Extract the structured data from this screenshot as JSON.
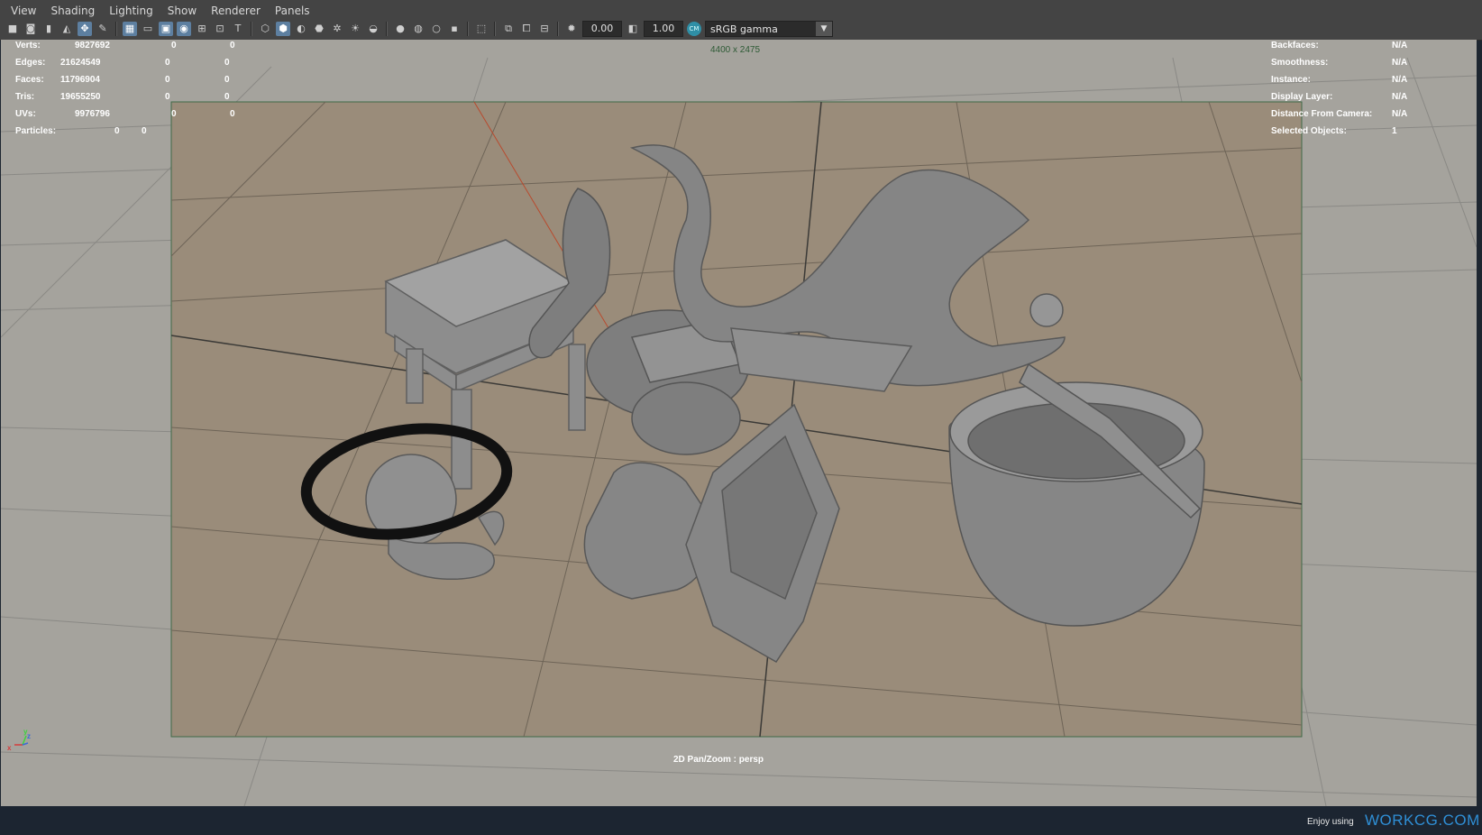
{
  "menu": [
    "View",
    "Shading",
    "Lighting",
    "Show",
    "Renderer",
    "Panels"
  ],
  "toolbar": {
    "exposure_value": "0.00",
    "gamma_value": "1.00",
    "color_mgmt_badge": "CM",
    "color_space": "sRGB gamma",
    "icons": [
      "select-camera-icon",
      "camera-attributes-icon",
      "bookmark-icon",
      "image-plane-icon",
      "2d-pan-zoom-icon",
      "grease-pencil-icon",
      "grid-icon",
      "film-gate-icon",
      "resolution-gate-icon",
      "gate-mask-icon",
      "field-chart-icon",
      "safe-action-icon",
      "safe-title-icon",
      "wireframe-icon",
      "smooth-shade-icon",
      "wireframe-on-shaded-icon",
      "textured-icon",
      "use-all-lights-icon",
      "shadows-icon",
      "screen-space-ao-icon",
      "motion-blur-icon",
      "multisample-aa-icon",
      "depth-of-field-icon",
      "isolate-select-icon",
      "xray-icon",
      "xray-joints-icon",
      "xray-components-icon",
      "exposure-icon",
      "gamma-icon",
      "color-management-icon"
    ]
  },
  "hud_left": [
    {
      "label": "Verts:",
      "c1": "9827692",
      "c2": "0",
      "c3": "0"
    },
    {
      "label": "Edges:",
      "c1": "21624549",
      "c2": "0",
      "c3": "0"
    },
    {
      "label": "Faces:",
      "c1": "11796904",
      "c2": "0",
      "c3": "0"
    },
    {
      "label": "Tris:",
      "c1": "19655250",
      "c2": "0",
      "c3": "0"
    },
    {
      "label": "UVs:",
      "c1": "9976796",
      "c2": "0",
      "c3": "0"
    },
    {
      "label": "Particles:",
      "c1": "0",
      "c2": "0",
      "c3": ""
    }
  ],
  "hud_right": [
    {
      "label": "Backfaces:",
      "value": "N/A"
    },
    {
      "label": "Smoothness:",
      "value": "N/A"
    },
    {
      "label": "Instance:",
      "value": "N/A"
    },
    {
      "label": "Display Layer:",
      "value": "N/A"
    },
    {
      "label": "Distance From Camera:",
      "value": "N/A"
    },
    {
      "label": "Selected Objects:",
      "value": "1"
    }
  ],
  "resolution_label": "4400 x 2475",
  "viewport_mode": "2D Pan/Zoom : persp",
  "axis": {
    "x": "x",
    "y": "y",
    "z": "z"
  },
  "status": {
    "left": "Enjoy using",
    "brand": "WORKCG.COM"
  },
  "colors": {
    "viewport_bg": "#a5a39d",
    "gate_bg": "#9a8c7a",
    "model_gray": "#7e7e7e",
    "selected_ring": "#111111",
    "brand": "#2f8fd6"
  }
}
